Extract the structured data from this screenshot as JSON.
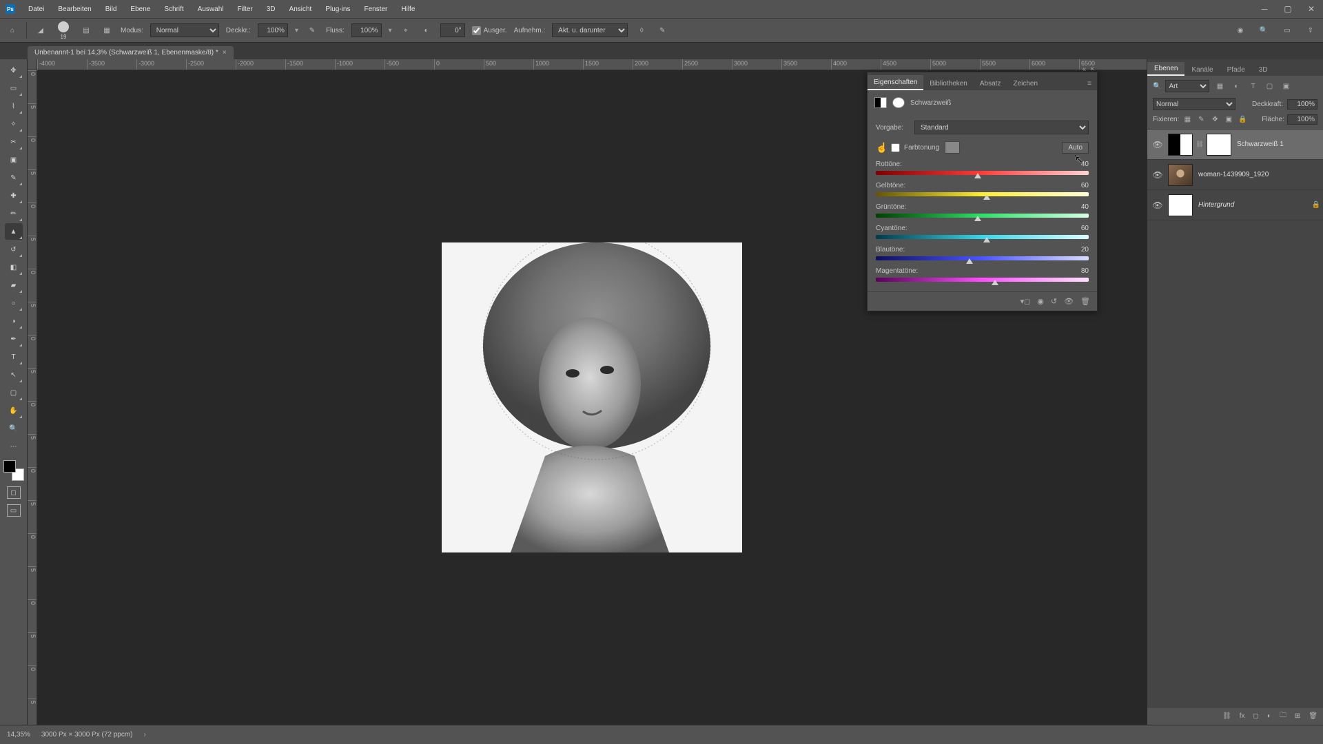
{
  "menu": {
    "items": [
      "Datei",
      "Bearbeiten",
      "Bild",
      "Ebene",
      "Schrift",
      "Auswahl",
      "Filter",
      "3D",
      "Ansicht",
      "Plug-ins",
      "Fenster",
      "Hilfe"
    ]
  },
  "doctab": {
    "title": "Unbenannt-1 bei 14,3% (Schwarzweiß 1, Ebenenmaske/8) *"
  },
  "optbar": {
    "brush_size": "19",
    "mode_label": "Modus:",
    "mode_value": "Normal",
    "opacity_label": "Deckkr.:",
    "opacity_value": "100%",
    "flow_label": "Fluss:",
    "flow_value": "100%",
    "smooth_label": "",
    "angle_value": "0°",
    "ausger_label": "Ausger.",
    "aufnehm_label": "Aufnehm.:",
    "aufnehm_value": "Akt. u. darunter"
  },
  "ruler_h": [
    "-4000",
    "-3500",
    "-3000",
    "-2500",
    "-2000",
    "-1500",
    "-1000",
    "-500",
    "0",
    "500",
    "1000",
    "1500",
    "2000",
    "2500",
    "3000",
    "3500",
    "4000",
    "4500",
    "5000",
    "5500",
    "6000",
    "6500"
  ],
  "ruler_v": [
    "0",
    "5",
    "0",
    "5",
    "0",
    "5",
    "0",
    "5",
    "0",
    "5",
    "0",
    "5",
    "0",
    "5",
    "0",
    "5",
    "0",
    "5",
    "0",
    "5"
  ],
  "props": {
    "tabs": [
      "Eigenschaften",
      "Bibliotheken",
      "Absatz",
      "Zeichen"
    ],
    "title": "Schwarzweiß",
    "preset_label": "Vorgabe:",
    "preset_value": "Standard",
    "tint_label": "Farbtonung",
    "auto_label": "Auto",
    "sliders": [
      {
        "name": "Rottöne:",
        "value": 40,
        "grad": "linear-gradient(90deg,#7f0000,#ff3b3b,#ffd2d2)"
      },
      {
        "name": "Gelbtöne:",
        "value": 60,
        "grad": "linear-gradient(90deg,#665500,#ffee33,#ffffd9)"
      },
      {
        "name": "Grüntöne:",
        "value": 40,
        "grad": "linear-gradient(90deg,#003f00,#2fe06a,#d6ffe4)"
      },
      {
        "name": "Cyantöne:",
        "value": 60,
        "grad": "linear-gradient(90deg,#003b4b,#36d6e8,#d9fbff)"
      },
      {
        "name": "Blautöne:",
        "value": 20,
        "grad": "linear-gradient(90deg,#0f0f5e,#4a55ff,#d9dcff)"
      },
      {
        "name": "Magentatöne:",
        "value": 80,
        "grad": "linear-gradient(90deg,#5b005b,#ff4dff,#ffe0ff)"
      }
    ]
  },
  "layers_panel": {
    "tabs": [
      "Ebenen",
      "Kanäle",
      "Pfade",
      "3D"
    ],
    "search_mode": "Art",
    "blend_mode": "Normal",
    "opacity_label": "Deckkraft:",
    "opacity_value": "100%",
    "lock_label": "Fixieren:",
    "fill_label": "Fläche:",
    "fill_value": "100%",
    "layers": [
      {
        "name": "Schwarzweiß 1",
        "kind": "adj",
        "selected": true,
        "mask": true
      },
      {
        "name": "woman-1439909_1920",
        "kind": "img",
        "selected": false,
        "mask": false
      },
      {
        "name": "Hintergrund",
        "kind": "bg",
        "selected": false,
        "mask": false,
        "locked": true
      }
    ]
  },
  "status": {
    "zoom": "14,35%",
    "docinfo": "3000 Px × 3000 Px (72 ppcm)"
  }
}
